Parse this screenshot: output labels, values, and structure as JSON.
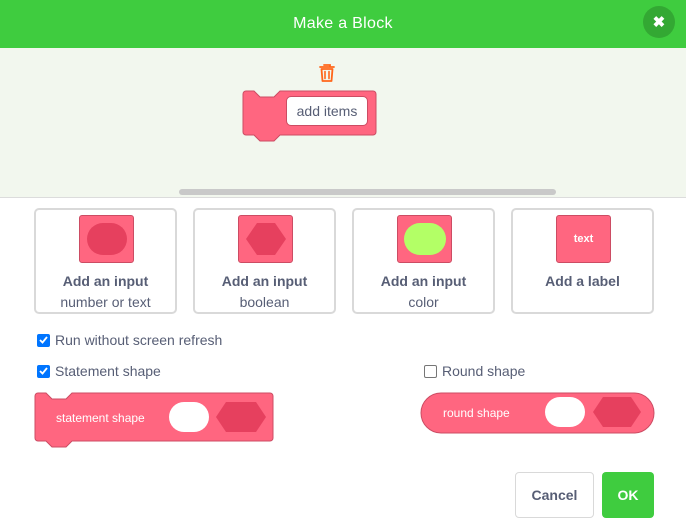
{
  "header": {
    "title": "Make a Block",
    "close_icon": "close-icon"
  },
  "preview": {
    "block_text": "add items",
    "trash_icon": "trash-icon"
  },
  "options": [
    {
      "title": "Add an input",
      "subtitle": "number or text",
      "icon": "oval-input-icon"
    },
    {
      "title": "Add an input",
      "subtitle": "boolean",
      "icon": "hexagon-input-icon"
    },
    {
      "title": "Add an input",
      "subtitle": "color",
      "icon": "color-input-icon"
    },
    {
      "title": "Add a label",
      "subtitle": "",
      "icon_text": "text"
    }
  ],
  "settings": {
    "run_without_refresh": {
      "label": "Run without screen refresh",
      "checked": true
    },
    "statement_shape": {
      "label": "Statement shape",
      "checked": true,
      "preview_text": "statement shape"
    },
    "round_shape": {
      "label": "Round shape",
      "checked": false,
      "preview_text": "round shape"
    }
  },
  "buttons": {
    "cancel": "Cancel",
    "ok": "OK"
  },
  "colors": {
    "header": "#3fcc3f",
    "block_fill": "#ff6680",
    "block_border": "#cc4c63",
    "color_swatch": "#b3ff66",
    "checkbox": "#0075ff"
  }
}
